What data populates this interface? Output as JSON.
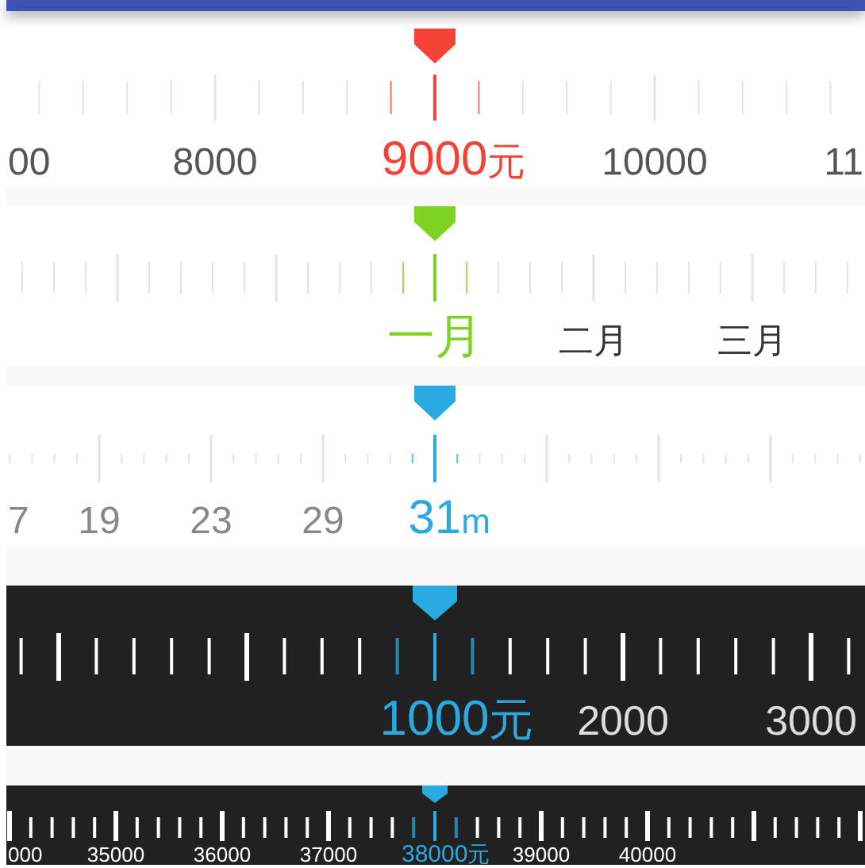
{
  "rulers": [
    {
      "kind": "money",
      "color": "#f44336",
      "unit": "元",
      "labels": [
        {
          "text": "00",
          "selected": false
        },
        {
          "text": "8000",
          "selected": false
        },
        {
          "text": "9000",
          "selected": true
        },
        {
          "text": "10000",
          "selected": false
        },
        {
          "text": "11",
          "selected": false
        }
      ]
    },
    {
      "kind": "month",
      "color": "#7ed321",
      "labels": [
        {
          "text": "一月",
          "selected": true
        },
        {
          "text": "二月",
          "selected": false
        },
        {
          "text": "三月",
          "selected": false
        }
      ]
    },
    {
      "kind": "distance",
      "color": "#29abe2",
      "unit": "m",
      "labels": [
        {
          "text": "7",
          "selected": false
        },
        {
          "text": "19",
          "selected": false
        },
        {
          "text": "23",
          "selected": false
        },
        {
          "text": "29",
          "selected": false
        },
        {
          "text": "31",
          "selected": true
        }
      ]
    },
    {
      "kind": "dark",
      "color": "#29abe2",
      "unit": "元",
      "labels": [
        {
          "text": "1000",
          "selected": true
        },
        {
          "text": "2000",
          "selected": false
        },
        {
          "text": "3000",
          "selected": false
        }
      ]
    },
    {
      "kind": "compact",
      "color": "#29abe2",
      "unit": "元",
      "labels": [
        {
          "text": "000",
          "selected": false
        },
        {
          "text": "35000",
          "selected": false
        },
        {
          "text": "36000",
          "selected": false
        },
        {
          "text": "37000",
          "selected": false
        },
        {
          "text": "38000",
          "selected": true
        },
        {
          "text": "39000",
          "selected": false
        },
        {
          "text": "40000",
          "selected": false
        }
      ]
    }
  ]
}
